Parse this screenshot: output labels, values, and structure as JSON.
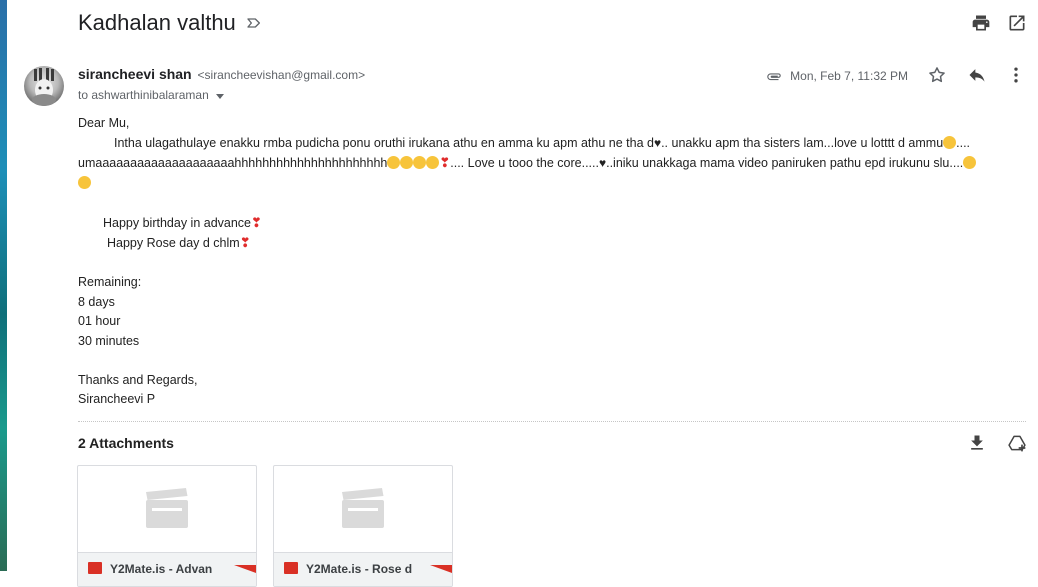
{
  "email": {
    "subject": "Kadhalan valthu",
    "sender_name": "sirancheevi shan",
    "sender_email": "<sirancheevishan@gmail.com>",
    "recipient": "to ashwarthinibalaraman",
    "date": "Mon, Feb 7, 11:32 PM"
  },
  "icons": {
    "label": "label-outline-icon",
    "print": "print-icon",
    "new_window": "open-in-new-icon",
    "attachment_clip": "paperclip-icon",
    "star": "star-outline-icon",
    "reply": "reply-icon",
    "more": "more-vert-icon",
    "download_all": "download-icon",
    "drive_add": "add-to-drive-icon"
  },
  "body": {
    "greeting": "Dear Mu,",
    "para1_a": "Intha ulagathulaye enakku rmba pudicha ponu oruthi irukana athu en amma ku apm athu ne tha d",
    "para1_b": ".. unakku apm tha sisters lam...love u lotttt d ammu",
    "para1_c": "....",
    "para2_a": "umaaaaaaaaaaaaaaaaaaaahhhhhhhhhhhhhhhhhhhhhh",
    "para2_b": ".... Love u tooo the core.....",
    "para2_c": "..iniku unakkaga mama video paniruken pathu epd irukunu slu....",
    "wish1": "Happy birthday in advance",
    "wish2": "Happy Rose day d chlm",
    "remaining_label": "Remaining:",
    "remaining_days": "8 days",
    "remaining_hours": "01 hour",
    "remaining_minutes": "30 minutes",
    "signoff": "Thanks and Regards,",
    "signature": "Sirancheevi P"
  },
  "attachments": {
    "title": "2 Attachments",
    "items": [
      {
        "name": "Y2Mate.is - Advan"
      },
      {
        "name": "Y2Mate.is - Rose d"
      }
    ]
  },
  "colors": {
    "icon_gray": "#5f6368",
    "accent_red": "#d93025",
    "heart_red": "#e02c2c",
    "emoji_yellow": "#f7c43b"
  }
}
